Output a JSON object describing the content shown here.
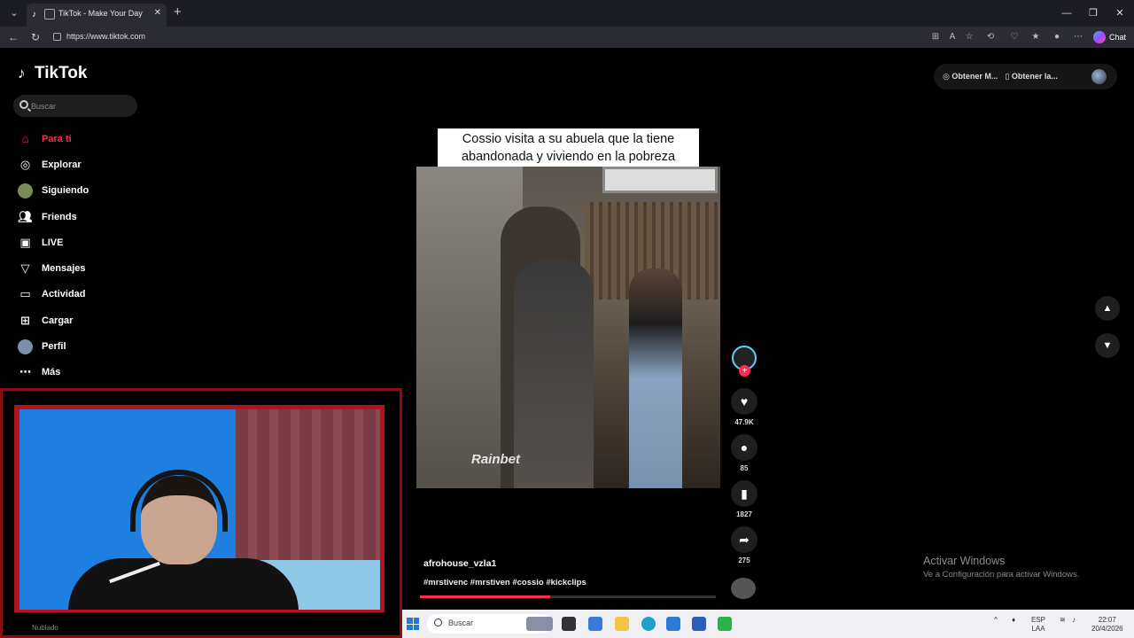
{
  "browser": {
    "tab_title": "TikTok - Make Your Day",
    "url": "https://www.tiktok.com",
    "chat_label": "Chat"
  },
  "tiktok": {
    "logo_text": "TikTok",
    "search_placeholder": "Buscar",
    "nav": [
      {
        "label": "Para ti",
        "icon": "home-icon",
        "active": true
      },
      {
        "label": "Explorar",
        "icon": "compass-icon",
        "active": false
      },
      {
        "label": "Siguiendo",
        "icon": "following-avatar-icon",
        "active": false
      },
      {
        "label": "Friends",
        "icon": "friends-icon",
        "active": false
      },
      {
        "label": "LIVE",
        "icon": "live-icon",
        "active": false
      },
      {
        "label": "Mensajes",
        "icon": "messages-icon",
        "active": false
      },
      {
        "label": "Actividad",
        "icon": "activity-icon",
        "active": false
      },
      {
        "label": "Cargar",
        "icon": "upload-icon",
        "active": false
      },
      {
        "label": "Perfil",
        "icon": "profile-avatar-icon",
        "active": false
      },
      {
        "label": "Más",
        "icon": "more-icon",
        "active": false
      }
    ],
    "top_right": {
      "get_coins": "Obtener M...",
      "get_app": "Obtener la..."
    },
    "video": {
      "caption_line1": "Cossio visita a su abuela que la tiene",
      "caption_line2": "abandonada y viviendo en la pobreza",
      "watermark": "Rainbet",
      "author": "afrohouse_vzla1",
      "hashtags": "#mrstivenc #mrstiven #cossio #kickclips",
      "progress": 0.44,
      "likes": "47.9K",
      "comments": "85",
      "saves": "1827",
      "shares": "275"
    }
  },
  "windows": {
    "activate_title": "Activar Windows",
    "activate_sub": "Ve a Configuración para activar Windows.",
    "taskbar_search": "Buscar",
    "lang_top": "ESP",
    "lang_bottom": "LAA",
    "time": "22:07",
    "date": "20/4/2026",
    "weather": "Nublado"
  },
  "colors": {
    "accent": "#fe2c55",
    "cam_border": "#b5121b"
  }
}
